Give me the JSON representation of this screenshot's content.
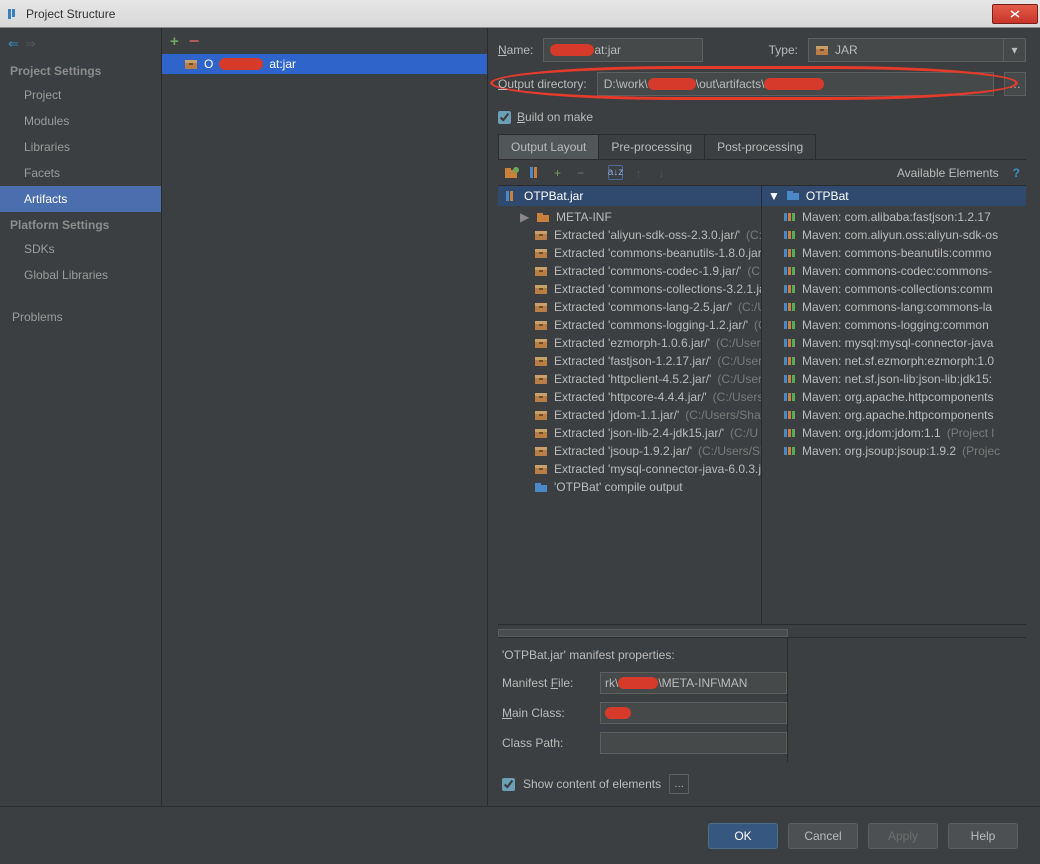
{
  "window": {
    "title": "Project Structure"
  },
  "nav": {
    "projectSettings": "Project Settings",
    "platformSettings": "Platform Settings",
    "items": {
      "project": "Project",
      "modules": "Modules",
      "libraries": "Libraries",
      "facets": "Facets",
      "artifacts": "Artifacts",
      "sdks": "SDKs",
      "globalLibraries": "Global Libraries",
      "problems": "Problems"
    }
  },
  "mid": {
    "artifactSuffix": "at:jar"
  },
  "form": {
    "nameLabel": "Name:",
    "nameSuffix": "at:jar",
    "typeLabel": "Type:",
    "typeValue": "JAR",
    "outDirLabel": "Output directory:",
    "outDirPrefix": "D:\\work\\",
    "outDirSuffix": "\\out\\artifacts\\",
    "buildOnMake": "Build on make"
  },
  "tabs": {
    "outputLayout": "Output Layout",
    "preProcessing": "Pre-processing",
    "postProcessing": "Post-processing"
  },
  "layout": {
    "availableElements": "Available Elements",
    "jarName": "OTPBat.jar",
    "metaInf": "META-INF",
    "entries": [
      {
        "text": "Extracted 'aliyun-sdk-oss-2.3.0.jar/'",
        "path": " (C:/"
      },
      {
        "text": "Extracted 'commons-beanutils-1.8.0.jar",
        "path": ""
      },
      {
        "text": "Extracted 'commons-codec-1.9.jar/'",
        "path": " (C:"
      },
      {
        "text": "Extracted 'commons-collections-3.2.1.ja",
        "path": ""
      },
      {
        "text": "Extracted 'commons-lang-2.5.jar/'",
        "path": " (C:/U"
      },
      {
        "text": "Extracted 'commons-logging-1.2.jar/'",
        "path": " (C"
      },
      {
        "text": "Extracted 'ezmorph-1.0.6.jar/'",
        "path": " (C:/Users"
      },
      {
        "text": "Extracted 'fastjson-1.2.17.jar/'",
        "path": " (C:/Users"
      },
      {
        "text": "Extracted 'httpclient-4.5.2.jar/'",
        "path": " (C:/Users"
      },
      {
        "text": "Extracted 'httpcore-4.4.4.jar/'",
        "path": " (C:/Users,"
      },
      {
        "text": "Extracted 'jdom-1.1.jar/'",
        "path": " (C:/Users/Shac"
      },
      {
        "text": "Extracted 'json-lib-2.4-jdk15.jar/'",
        "path": " (C:/U"
      },
      {
        "text": "Extracted 'jsoup-1.9.2.jar/'",
        "path": " (C:/Users/Sh"
      },
      {
        "text": "Extracted 'mysql-connector-java-6.0.3.ja",
        "path": ""
      }
    ],
    "compileOutput": "'OTPBat' compile output",
    "moduleName": "OTPBat",
    "libs": [
      "Maven: com.alibaba:fastjson:1.2.17",
      "Maven: com.aliyun.oss:aliyun-sdk-os",
      "Maven: commons-beanutils:commo",
      "Maven: commons-codec:commons-",
      "Maven: commons-collections:comm",
      "Maven: commons-lang:commons-la",
      "Maven: commons-logging:common",
      "Maven: mysql:mysql-connector-java",
      "Maven: net.sf.ezmorph:ezmorph:1.0",
      "Maven: net.sf.json-lib:json-lib:jdk15:",
      "Maven: org.apache.httpcomponents",
      "Maven: org.apache.httpcomponents"
    ],
    "libsGrey": [
      {
        "t": "Maven: org.jdom:jdom:1.1",
        "g": " (Project l"
      },
      {
        "t": "Maven: org.jsoup:jsoup:1.9.2",
        "g": " (Projec"
      }
    ]
  },
  "manifest": {
    "title": "'OTPBat.jar' manifest properties:",
    "fileLabel": "Manifest File:",
    "filePrefix": "rk\\",
    "fileSuffix": "\\META-INF\\MAN",
    "mainClassLabel": "Main Class:",
    "classPathLabel": "Class Path:"
  },
  "showContent": "Show content of elements",
  "buttons": {
    "ok": "OK",
    "cancel": "Cancel",
    "apply": "Apply",
    "help": "Help"
  }
}
